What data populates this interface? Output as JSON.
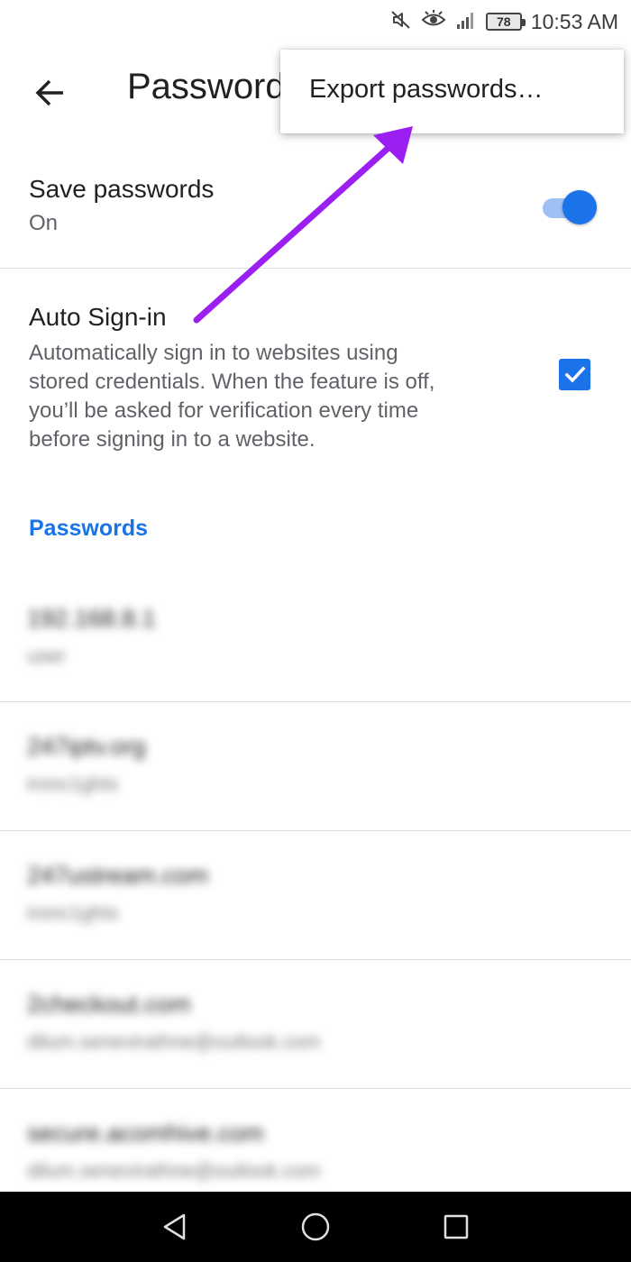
{
  "status_bar": {
    "battery": "78",
    "time": "10:53 AM",
    "icons": [
      "mute-icon",
      "eye-icon",
      "signal-icon",
      "battery-icon"
    ]
  },
  "app_bar": {
    "title": "Passwords",
    "back_icon": "back-arrow-icon"
  },
  "overflow_menu": {
    "items": [
      {
        "label": "Export passwords…"
      }
    ]
  },
  "settings": {
    "save_passwords": {
      "title": "Save passwords",
      "state": "On",
      "enabled": true
    },
    "auto_signin": {
      "title": "Auto Sign-in",
      "description_lines": [
        "Automatically sign in to websites using",
        "stored credentials. When the feature is off,",
        "you’ll be asked for verification every time",
        "before signing in to a website."
      ],
      "checked": true
    }
  },
  "passwords_section": {
    "header": "Passwords",
    "items": [
      {
        "site": "192.168.8.1",
        "user": "user"
      },
      {
        "site": "247iptv.org",
        "user": "ironc1ghts"
      },
      {
        "site": "247ustream.com",
        "user": "ironc1ghts"
      },
      {
        "site": "2checkout.com",
        "user": "dilum.senevirathne@outlook.com"
      },
      {
        "site": "secure.acomhive.com",
        "user": "dilum.senevirathne@outlook.com"
      }
    ]
  },
  "nav_bar": {
    "buttons": [
      "back-triangle-icon",
      "home-circle-icon",
      "recents-square-icon"
    ]
  },
  "colors": {
    "accent": "#1a73e8",
    "annotation_arrow": "#9b1ff0"
  }
}
